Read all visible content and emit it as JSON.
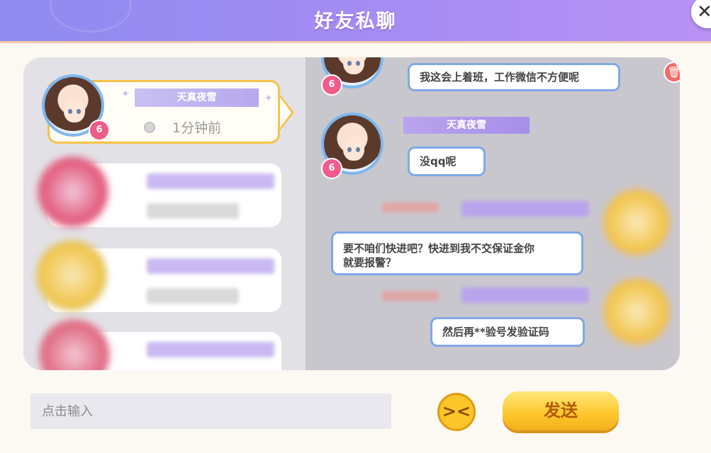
{
  "header": {
    "title": "好友私聊",
    "close_icon": "close-icon"
  },
  "friends": [
    {
      "name": "天真夜雪",
      "status": "1分钟前",
      "level": "6",
      "active": true
    },
    {
      "name": "",
      "status": "",
      "level": "",
      "active": false,
      "obscured": true
    },
    {
      "name": "",
      "status": "",
      "level": "",
      "active": false,
      "obscured": true
    },
    {
      "name": "",
      "status": "",
      "level": "",
      "active": false,
      "obscured": true
    }
  ],
  "chat": {
    "messages": [
      {
        "sender": "friend",
        "text": "我这会上着班，工作微信不方便呢",
        "level": "6"
      },
      {
        "sender": "friend",
        "name": "天真夜雪",
        "text": "没qq呢",
        "level": "6"
      },
      {
        "sender": "me",
        "text": "要不咱们快进吧？快进到我不交保证金你\n就要报警？",
        "obscured_name": true
      },
      {
        "sender": "me",
        "text": "然后再**验号发验证码",
        "obscured_name": true
      }
    ],
    "delete_icon": "trash-icon"
  },
  "input": {
    "placeholder": "点击输入",
    "value": ""
  },
  "emoji_icon": "emoji-icon",
  "send_label": "发送",
  "colors": {
    "accent": "#8f8bf0",
    "bubble_border": "#7fa9e6",
    "send": "#fcc62a"
  }
}
